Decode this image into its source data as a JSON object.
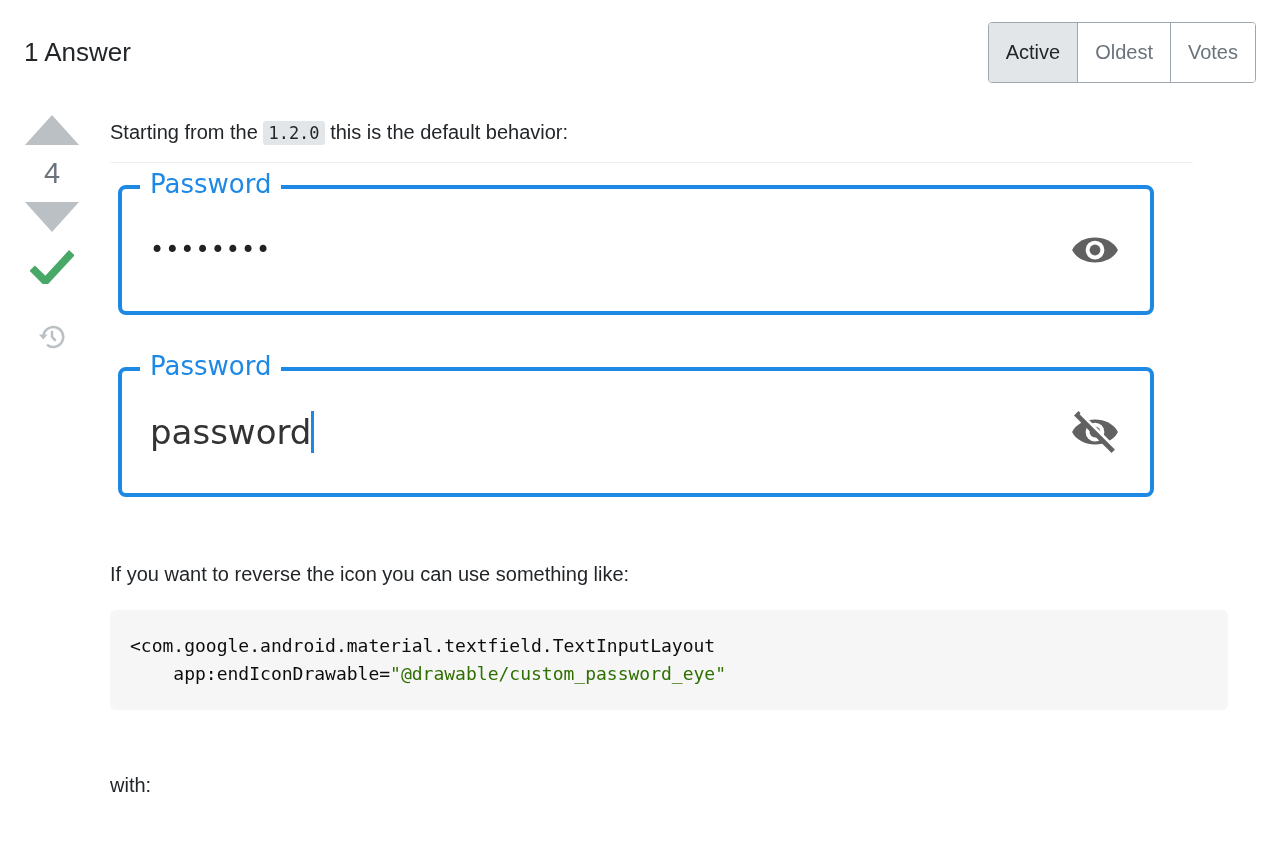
{
  "heading": "1 Answer",
  "sort_tabs": [
    {
      "label": "Active",
      "selected": true
    },
    {
      "label": "Oldest",
      "selected": false
    },
    {
      "label": "Votes",
      "selected": false
    }
  ],
  "votes": {
    "score": "4",
    "accepted": true
  },
  "intro": [
    {
      "kind": "text",
      "text": "Starting from the "
    },
    {
      "kind": "code",
      "text": "1.2.0"
    },
    {
      "kind": "text",
      "text": " this is the default behavior:"
    }
  ],
  "fields": [
    {
      "label": "Password",
      "value": "••••••••",
      "revealed": false,
      "cursor": false
    },
    {
      "label": "Password",
      "value": "password",
      "revealed": true,
      "cursor": true
    }
  ],
  "paragraph": "If you want to reverse the icon you can use something like:",
  "code_lines": [
    [
      {
        "kind": "plain",
        "text": "<com.google.android.material.textfield.TextInputLayout"
      }
    ],
    [
      {
        "kind": "plain",
        "text": "    app:endIconDrawable="
      },
      {
        "kind": "string",
        "text": "\"@drawable/custom_password_eye\""
      }
    ]
  ],
  "outro": "with:"
}
